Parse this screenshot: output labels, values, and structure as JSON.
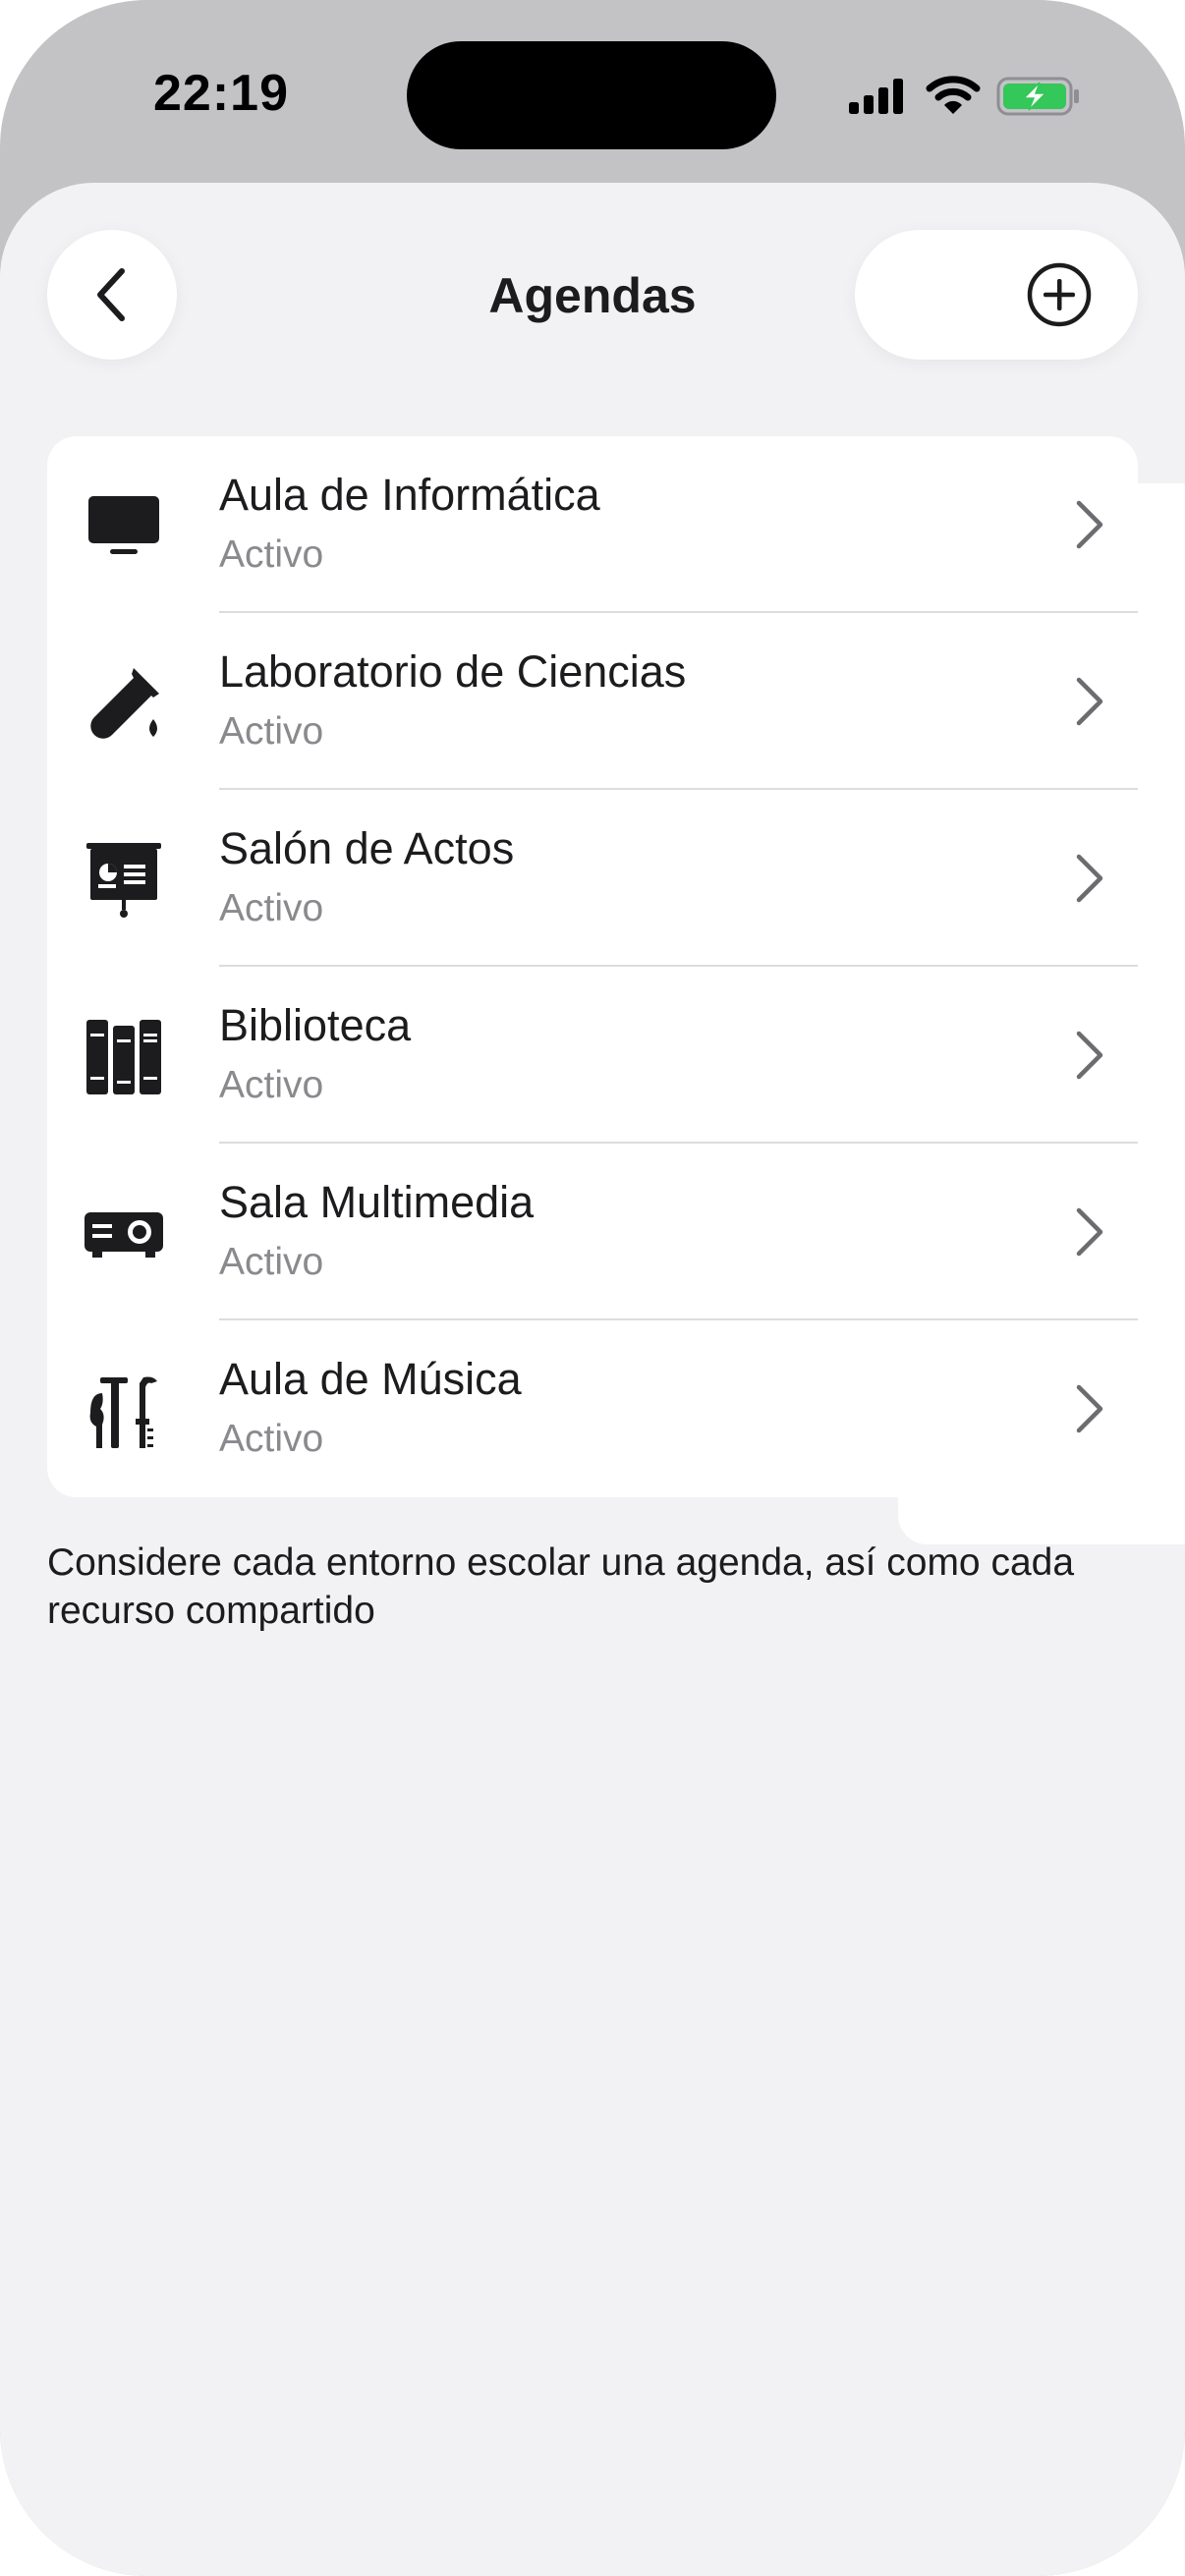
{
  "status_bar": {
    "time": "22:19"
  },
  "nav": {
    "title": "Agendas"
  },
  "items": [
    {
      "title": "Aula de Informática",
      "status": "Activo",
      "icon": "monitor-icon"
    },
    {
      "title": "Laboratorio de Ciencias",
      "status": "Activo",
      "icon": "test-tube-icon"
    },
    {
      "title": "Salón de Actos",
      "status": "Activo",
      "icon": "presentation-board-icon"
    },
    {
      "title": "Biblioteca",
      "status": "Activo",
      "icon": "books-icon"
    },
    {
      "title": "Sala Multimedia",
      "status": "Activo",
      "icon": "projector-icon"
    },
    {
      "title": "Aula de Música",
      "status": "Activo",
      "icon": "music-instruments-icon"
    }
  ],
  "footer": {
    "note": "Considere cada entorno escolar una agenda, así como cada recurso compartido"
  },
  "colors": {
    "sheet_background": "#f2f2f4",
    "battery_green": "#34c759",
    "secondary_text": "#8a8a8e"
  }
}
